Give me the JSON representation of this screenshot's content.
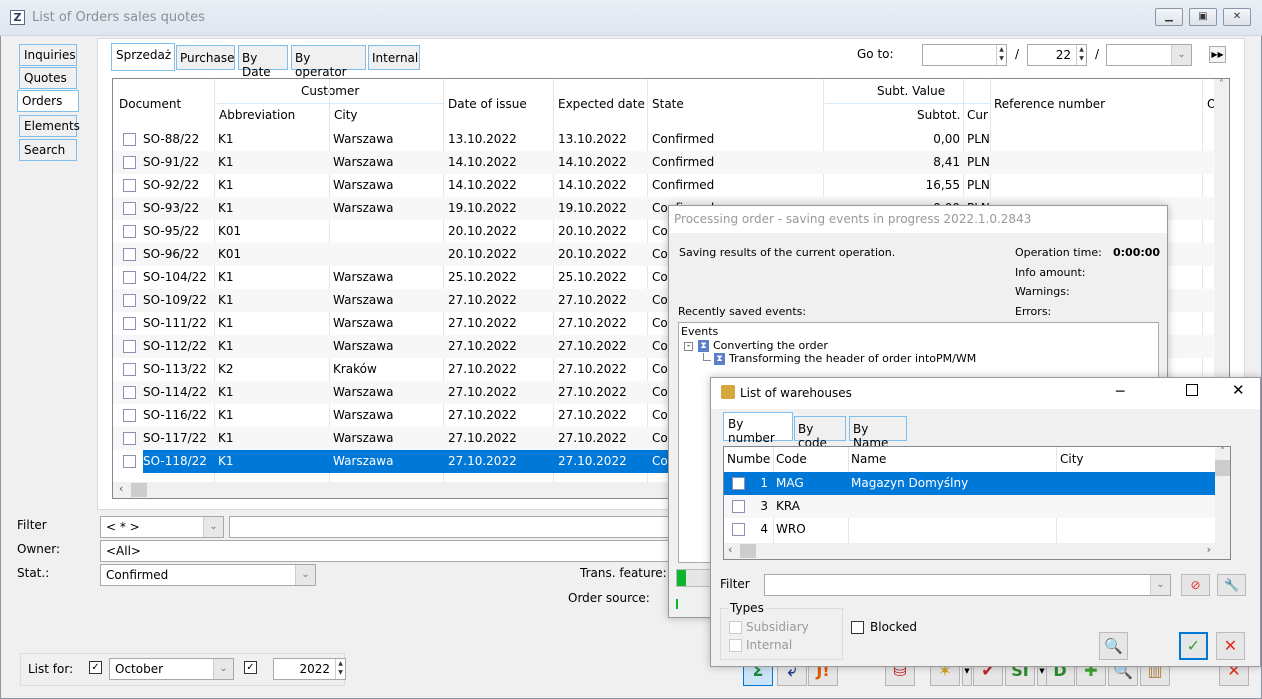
{
  "window": {
    "title": "List of Orders sales quotes",
    "app_icon": "Z"
  },
  "nav": [
    {
      "label": "Inquiries"
    },
    {
      "label": "Quotes"
    },
    {
      "label": "Orders"
    },
    {
      "label": "Elements"
    },
    {
      "label": "Search"
    }
  ],
  "tabs": [
    {
      "label": "Sprzedaż"
    },
    {
      "label": "Purchase"
    },
    {
      "label": "By Date"
    },
    {
      "label": "By operator"
    },
    {
      "label": "Internal"
    }
  ],
  "goto": {
    "label": "Go to:",
    "field1": "",
    "sep": "/",
    "field2": "22",
    "field3": ""
  },
  "grid": {
    "headers": {
      "document": "Document",
      "customer": "Customer",
      "abbreviation": "Abbreviation",
      "city": "City",
      "date_issue": "Date of issue",
      "expected_date": "Expected date",
      "state": "State",
      "subt_value": "Subt. Value",
      "subtot": "Subtot.",
      "cur": "Cur",
      "reference": "Reference number",
      "or": "Or"
    },
    "rows": [
      {
        "doc": "SO-88/22",
        "abbr": "K1",
        "city": "Warszawa",
        "issue": "13.10.2022",
        "expected": "13.10.2022",
        "state": "Confirmed",
        "subtot": "0,00",
        "cur": "PLN"
      },
      {
        "doc": "SO-91/22",
        "abbr": "K1",
        "city": "Warszawa",
        "issue": "14.10.2022",
        "expected": "14.10.2022",
        "state": "Confirmed",
        "subtot": "8,41",
        "cur": "PLN"
      },
      {
        "doc": "SO-92/22",
        "abbr": "K1",
        "city": "Warszawa",
        "issue": "14.10.2022",
        "expected": "14.10.2022",
        "state": "Confirmed",
        "subtot": "16,55",
        "cur": "PLN"
      },
      {
        "doc": "SO-93/22",
        "abbr": "K1",
        "city": "Warszawa",
        "issue": "19.10.2022",
        "expected": "19.10.2022",
        "state": "Confirmed",
        "subtot": "0,00",
        "cur": "PLN"
      },
      {
        "doc": "SO-95/22",
        "abbr": "K01",
        "city": "",
        "issue": "20.10.2022",
        "expected": "20.10.2022",
        "state": "Con",
        "subtot": "",
        "cur": ""
      },
      {
        "doc": "SO-96/22",
        "abbr": "K01",
        "city": "",
        "issue": "20.10.2022",
        "expected": "20.10.2022",
        "state": "Con",
        "subtot": "",
        "cur": ""
      },
      {
        "doc": "SO-104/22",
        "abbr": "K1",
        "city": "Warszawa",
        "issue": "25.10.2022",
        "expected": "25.10.2022",
        "state": "Con",
        "subtot": "",
        "cur": ""
      },
      {
        "doc": "SO-109/22",
        "abbr": "K1",
        "city": "Warszawa",
        "issue": "27.10.2022",
        "expected": "27.10.2022",
        "state": "Con",
        "subtot": "",
        "cur": ""
      },
      {
        "doc": "SO-111/22",
        "abbr": "K1",
        "city": "Warszawa",
        "issue": "27.10.2022",
        "expected": "27.10.2022",
        "state": "Con",
        "subtot": "",
        "cur": ""
      },
      {
        "doc": "SO-112/22",
        "abbr": "K1",
        "city": "Warszawa",
        "issue": "27.10.2022",
        "expected": "27.10.2022",
        "state": "Con",
        "subtot": "",
        "cur": ""
      },
      {
        "doc": "SO-113/22",
        "abbr": "K2",
        "city": "Kraków",
        "issue": "27.10.2022",
        "expected": "27.10.2022",
        "state": "Con",
        "subtot": "",
        "cur": ""
      },
      {
        "doc": "SO-114/22",
        "abbr": "K1",
        "city": "Warszawa",
        "issue": "27.10.2022",
        "expected": "27.10.2022",
        "state": "Con",
        "subtot": "",
        "cur": ""
      },
      {
        "doc": "SO-116/22",
        "abbr": "K1",
        "city": "Warszawa",
        "issue": "27.10.2022",
        "expected": "27.10.2022",
        "state": "Con",
        "subtot": "",
        "cur": ""
      },
      {
        "doc": "SO-117/22",
        "abbr": "K1",
        "city": "Warszawa",
        "issue": "27.10.2022",
        "expected": "27.10.2022",
        "state": "Con",
        "subtot": "",
        "cur": ""
      },
      {
        "doc": "SO-118/22",
        "abbr": "K1",
        "city": "Warszawa",
        "issue": "27.10.2022",
        "expected": "27.10.2022",
        "state": "Con",
        "subtot": "",
        "cur": "",
        "selected": true
      }
    ]
  },
  "filters": {
    "filter_label": "Filter",
    "filter_value": "< * >",
    "filter_text": "",
    "owner_label": "Owner:",
    "owner_value": "<All>",
    "stat_label": "Stat.:",
    "stat_value": "Confirmed",
    "trans_feature_label": "Trans. feature:",
    "order_source_label": "Order source:"
  },
  "list_for": {
    "label": "List for:",
    "month": "October",
    "month_checked": true,
    "year_checked": true,
    "year": "2022"
  },
  "toolbar": {
    "icons": [
      "sum-icon",
      "export-icon",
      "document-alert-icon",
      "database-icon",
      "wand-icon",
      "document-check-icon",
      "document-si-icon",
      "document-d-icon",
      "add-icon",
      "search-icon",
      "delete-icon",
      "close-icon"
    ]
  },
  "processing": {
    "title": "Processing order - saving events in progress 2022.1.0.2843",
    "message": "Saving results of the current operation.",
    "op_time_label": "Operation time:",
    "op_time": "0:00:00",
    "info_label": "Info amount:",
    "warnings_label": "Warnings:",
    "errors_label": "Errors:",
    "recent_label": "Recently saved events:",
    "tree_root": "Events",
    "tree_item1": "Converting the order",
    "tree_item2": "Transforming the header of order intoPM/WM",
    "progress": 0.03
  },
  "warehouses": {
    "title": "List of warehouses",
    "tabs": [
      {
        "label": "By number"
      },
      {
        "label": "By code"
      },
      {
        "label": "By Name"
      }
    ],
    "headers": {
      "number": "Numbe",
      "code": "Code",
      "name": "Name",
      "city": "City"
    },
    "rows": [
      {
        "number": "1",
        "code": "MAG",
        "name": "Magazyn Domyślny",
        "city": "",
        "selected": true
      },
      {
        "number": "3",
        "code": "KRA",
        "name": "",
        "city": ""
      },
      {
        "number": "4",
        "code": "WRO",
        "name": "",
        "city": ""
      }
    ],
    "filter_label": "Filter",
    "filter_value": "",
    "types_label": "Types",
    "subsidiary": "Subsidiary",
    "internal": "Internal",
    "blocked": "Blocked"
  },
  "colors": {
    "selection": "#0078d7",
    "tab_border": "#7fbfee",
    "progress": "#0bb52c",
    "ok": "#3aa335",
    "cancel": "#e22b1e"
  }
}
